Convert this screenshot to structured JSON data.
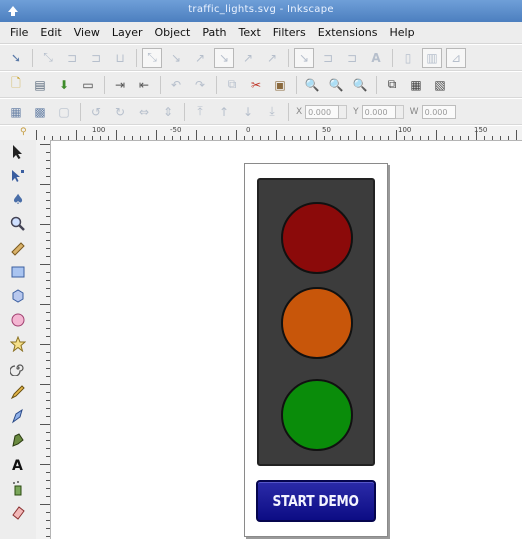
{
  "window": {
    "title": "traffic_lights.svg - Inkscape",
    "app_icon": "inkscape-icon"
  },
  "menu": [
    "File",
    "Edit",
    "View",
    "Layer",
    "Object",
    "Path",
    "Text",
    "Filters",
    "Extensions",
    "Help"
  ],
  "toolbar_rows": {
    "row1_icons": [
      "node-select-icon",
      "snap-icon",
      "snap-icon",
      "snap-icon",
      "snap-icon",
      "snap-box-icon",
      "snap-icon",
      "snap-icon",
      "snap-box-icon",
      "snap-icon",
      "snap-icon",
      "snap-box-icon",
      "snap-icon",
      "snap-icon",
      "text-snap-icon",
      "page-icon",
      "grid-icon",
      "guide-icon"
    ],
    "row2_icons": [
      "new-document-icon",
      "open-icon",
      "save-icon",
      "print-icon",
      "import-icon",
      "export-icon",
      "undo-icon",
      "redo-icon",
      "copy-icon",
      "cut-icon",
      "paste-icon",
      "zoom-selection-icon",
      "zoom-drawing-icon",
      "zoom-page-icon",
      "duplicate-icon",
      "clone-icon",
      "unlink-clone-icon"
    ]
  },
  "coords": {
    "x_label": "X",
    "x_value": "0.000",
    "y_label": "Y",
    "y_value": "0.000",
    "w_label": "W",
    "w_value": "0.000"
  },
  "ruler": {
    "labels": [
      "100",
      "-50",
      "0",
      "50",
      "100",
      "150"
    ]
  },
  "tools": [
    "selector-icon",
    "node-icon",
    "tweak-icon",
    "zoom-icon",
    "measure-icon",
    "rectangle-icon",
    "box-3d-icon",
    "ellipse-icon",
    "star-icon",
    "spiral-icon",
    "pencil-icon",
    "pen-icon",
    "calligraphy-icon",
    "text-icon",
    "spray-icon",
    "eraser-icon"
  ],
  "drawing": {
    "colors": {
      "red": "#8b0a0a",
      "amber": "#c8560a",
      "green": "#0a8c0a",
      "housing": "#3c3c3c",
      "button": "#14148f"
    },
    "button_label": "START DEMO"
  }
}
